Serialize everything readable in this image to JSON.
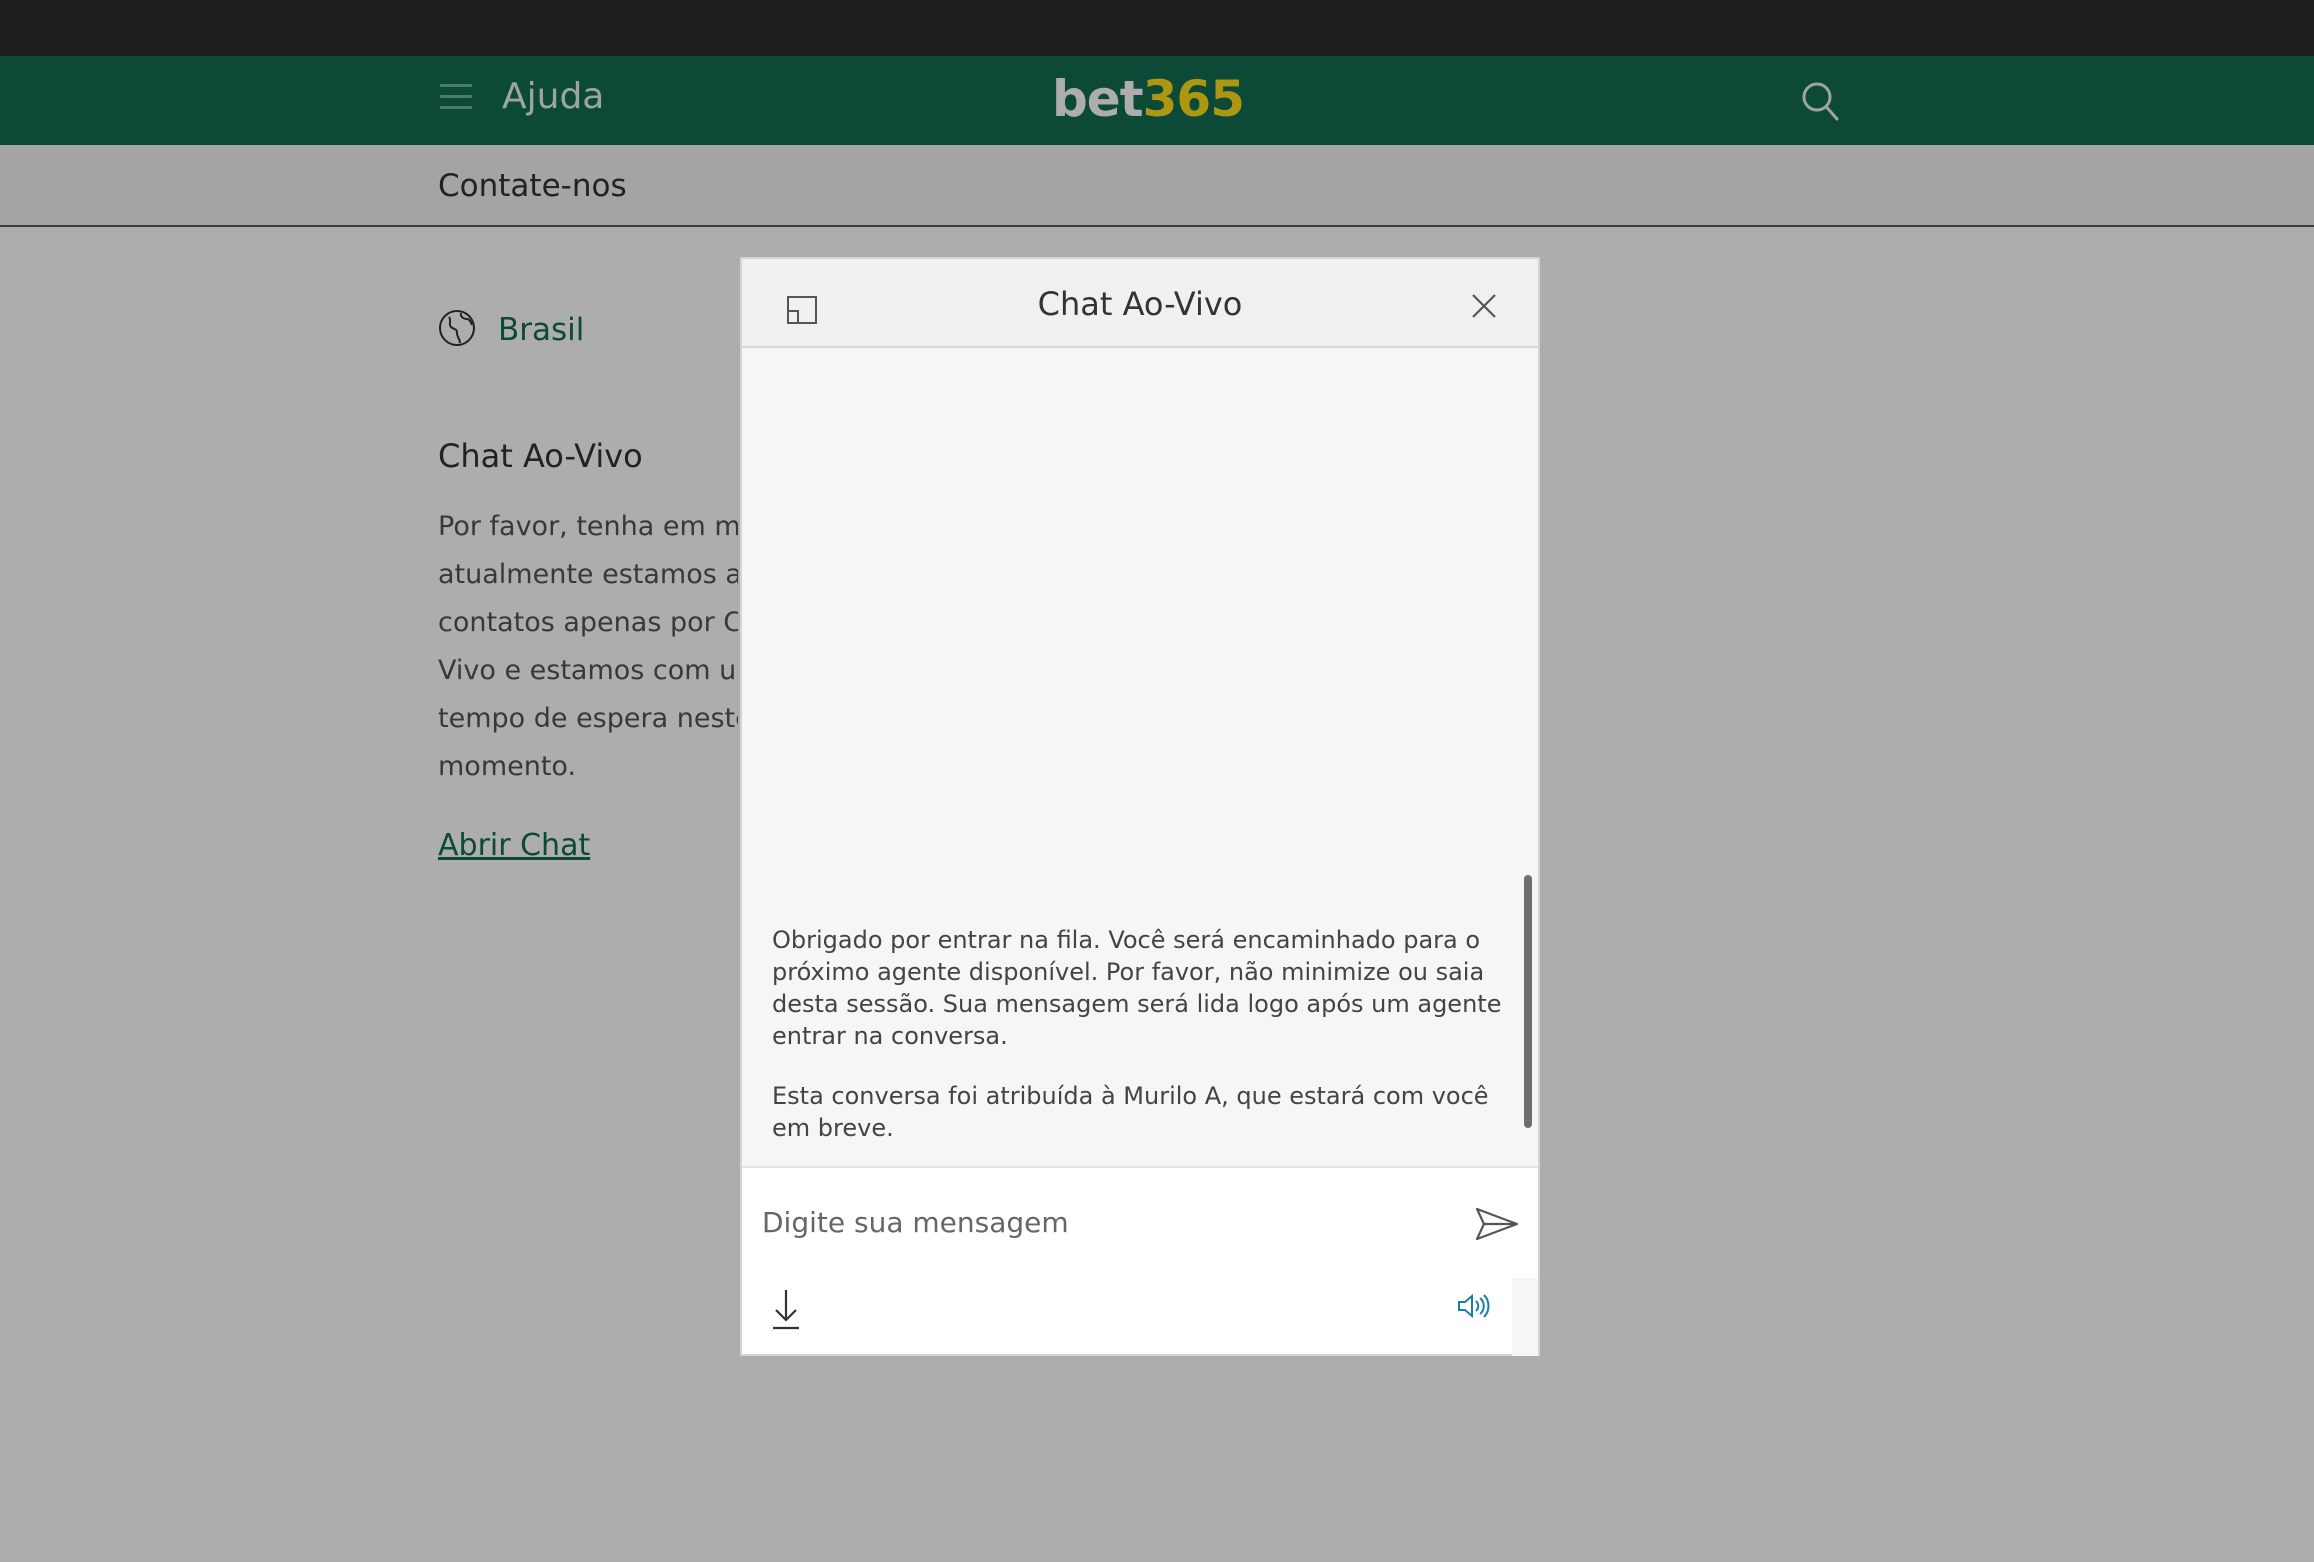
{
  "header": {
    "section_label": "Ajuda",
    "logo_bet": "bet",
    "logo_num": "365",
    "brand_color": "#126e51",
    "logo_accent_color": "#ffdf1b"
  },
  "subheader": {
    "title": "Contate-nos"
  },
  "content": {
    "country": "Brasil",
    "section_title": "Chat Ao-Vivo",
    "lines": [
      "Por favor, tenha em me",
      "atualmente estamos ac",
      "contatos apenas por Ch",
      "Vivo e estamos com un",
      "tempo de espera neste",
      "momento."
    ],
    "open_chat_link": "Abrir Chat"
  },
  "chat": {
    "title": "Chat Ao-Vivo",
    "messages": [
      "Obrigado por entrar na fila. Você será encaminhado para o próximo agente disponível. Por favor, não minimize ou saia desta sessão. Sua mensagem será lida logo após um agente entrar na conversa.",
      "Esta conversa foi atribuída à Murilo A, que estará com você em breve."
    ],
    "input_placeholder": "Digite sua mensagem",
    "input_value": "",
    "sound_icon_color": "#1a7fa8"
  },
  "icons": [
    "menu-icon",
    "search-icon",
    "globe-icon",
    "popout-icon",
    "close-icon",
    "send-icon",
    "download-icon",
    "sound-icon"
  ]
}
